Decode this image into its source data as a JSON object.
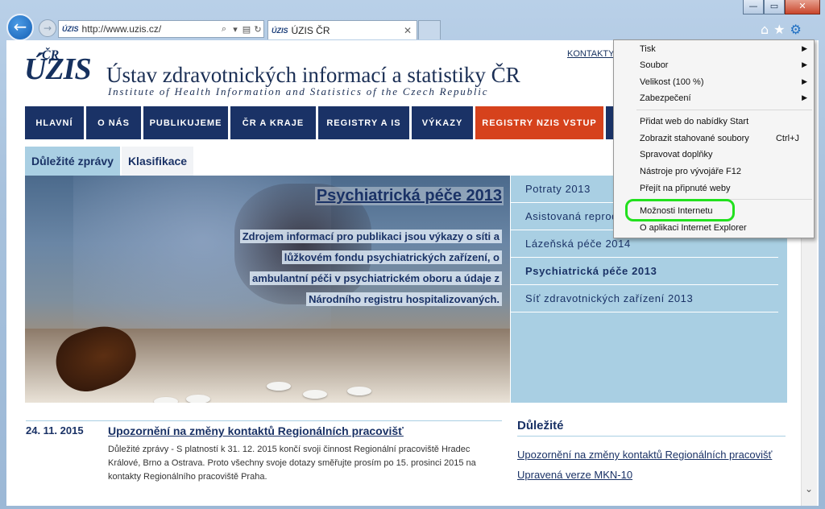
{
  "browser": {
    "address_url": "http://www.uzis.cz/",
    "favicon_text": "ÚZIS",
    "tab_title": "ÚZIS ČR",
    "window_buttons": [
      "—",
      "▭",
      "✕"
    ],
    "nav_icons": [
      "home-icon",
      "star-icon",
      "gear-icon"
    ]
  },
  "menu": {
    "items": [
      {
        "label": "Tisk",
        "submenu": true
      },
      {
        "label": "Soubor",
        "submenu": true
      },
      {
        "label": "Velikost (100 %)",
        "submenu": true
      },
      {
        "label": "Zabezpečení",
        "submenu": true
      },
      {
        "label": "Přidat web do nabídky Start"
      },
      {
        "label": "Zobrazit stahované soubory",
        "shortcut": "Ctrl+J"
      },
      {
        "label": "Spravovat doplňky"
      },
      {
        "label": "Nástroje pro vývojáře F12"
      },
      {
        "label": "Přejít na připnuté weby"
      },
      {
        "label": "Možnosti Internetu"
      },
      {
        "label": "O aplikaci Internet Explorer"
      }
    ],
    "highlight_color": "#22e01e"
  },
  "site": {
    "logo": "ÚZIS",
    "logo_cr": "ČR",
    "org_name": "Ústav zdravotnických informací a statistiky ČR",
    "org_subtitle": "Institute of Health Information and Statistics of the Czech Republic",
    "kontakty": "KONTAKTY",
    "nav": [
      "HLAVNÍ",
      "O NÁS",
      "PUBLIKUJEME",
      "ČR A KRAJE",
      "REGISTRY A IS",
      "VÝKAZY",
      "REGISTRY NZIS VSTUP"
    ],
    "subtabs": [
      "Důležité zprávy",
      "Klasifikace"
    ],
    "hero": {
      "title": "Psychiatrická péče 2013",
      "lines": [
        "Zdrojem informací pro publikaci jsou výkazy o síti a",
        "lůžkovém fondu psychiatrických zařízení, o",
        "ambulantní péči v psychiatrickém oboru a údaje z",
        "Národního registru hospitalizovaných."
      ]
    },
    "right_list": [
      "Potraty 2013",
      "Asistovaná reprodukce",
      "Lázeňská péče 2014",
      "Psychiatrická péče 2013",
      "Síť zdravotnických zařízení 2013"
    ],
    "news": {
      "date": "24. 11. 2015",
      "title": "Upozornění na změny kontaktů Regionálních pracovišť",
      "body": "Důležité zprávy - S platností k 31. 12. 2015 končí svoji činnost Regionální pracoviště Hradec Králové, Brno a Ostrava. Proto všechny svoje dotazy směřujte prosím po 15. prosinci 2015 na kontakty Regionálního pracoviště Praha."
    },
    "important": {
      "heading": "Důležité",
      "links": [
        "Upozornění na změny kontaktů Regionálních pracovišť",
        "Upravená verze MKN-10"
      ]
    }
  },
  "colors": {
    "navy": "#1a3266",
    "accent_red": "#d6421c",
    "light_blue": "#a9cfe3"
  }
}
